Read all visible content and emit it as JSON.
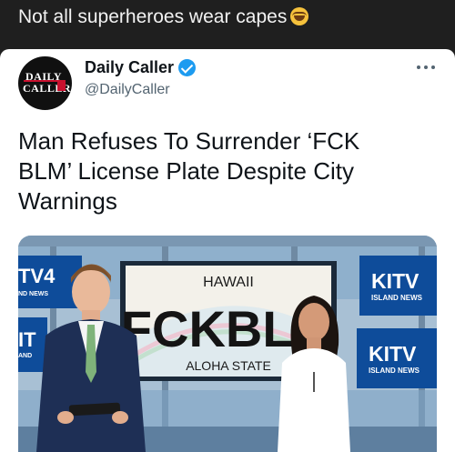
{
  "caption": {
    "text": "Not all superheroes wear capes",
    "emoji": "laughing-face"
  },
  "tweet": {
    "avatar": {
      "line1": "DAILY",
      "line2": "CALLER"
    },
    "display_name": "Daily Caller",
    "verified": true,
    "handle": "@DailyCaller",
    "headline": "Man Refuses To Surrender ‘FCK BLM’ License Plate Despite City Warnings"
  },
  "media": {
    "plate_top": "HAWAII",
    "plate_number": "FCKBLM",
    "plate_bottom": "ALOHA STATE",
    "logo_left_1": "TV4",
    "logo_left_1_sub": "ND NEWS",
    "logo_left_2": "IT",
    "logo_left_2_sub": "AND",
    "logo_right_1": "KITV",
    "logo_right_1_sub": "ISLAND NEWS",
    "logo_right_2": "KITV",
    "logo_right_2_sub": "ISLAND NEWS"
  },
  "colors": {
    "brand_blue": "#1d9bf0",
    "text": "#0f1419",
    "muted": "#536471",
    "kitv_blue": "#0e4c9a"
  }
}
